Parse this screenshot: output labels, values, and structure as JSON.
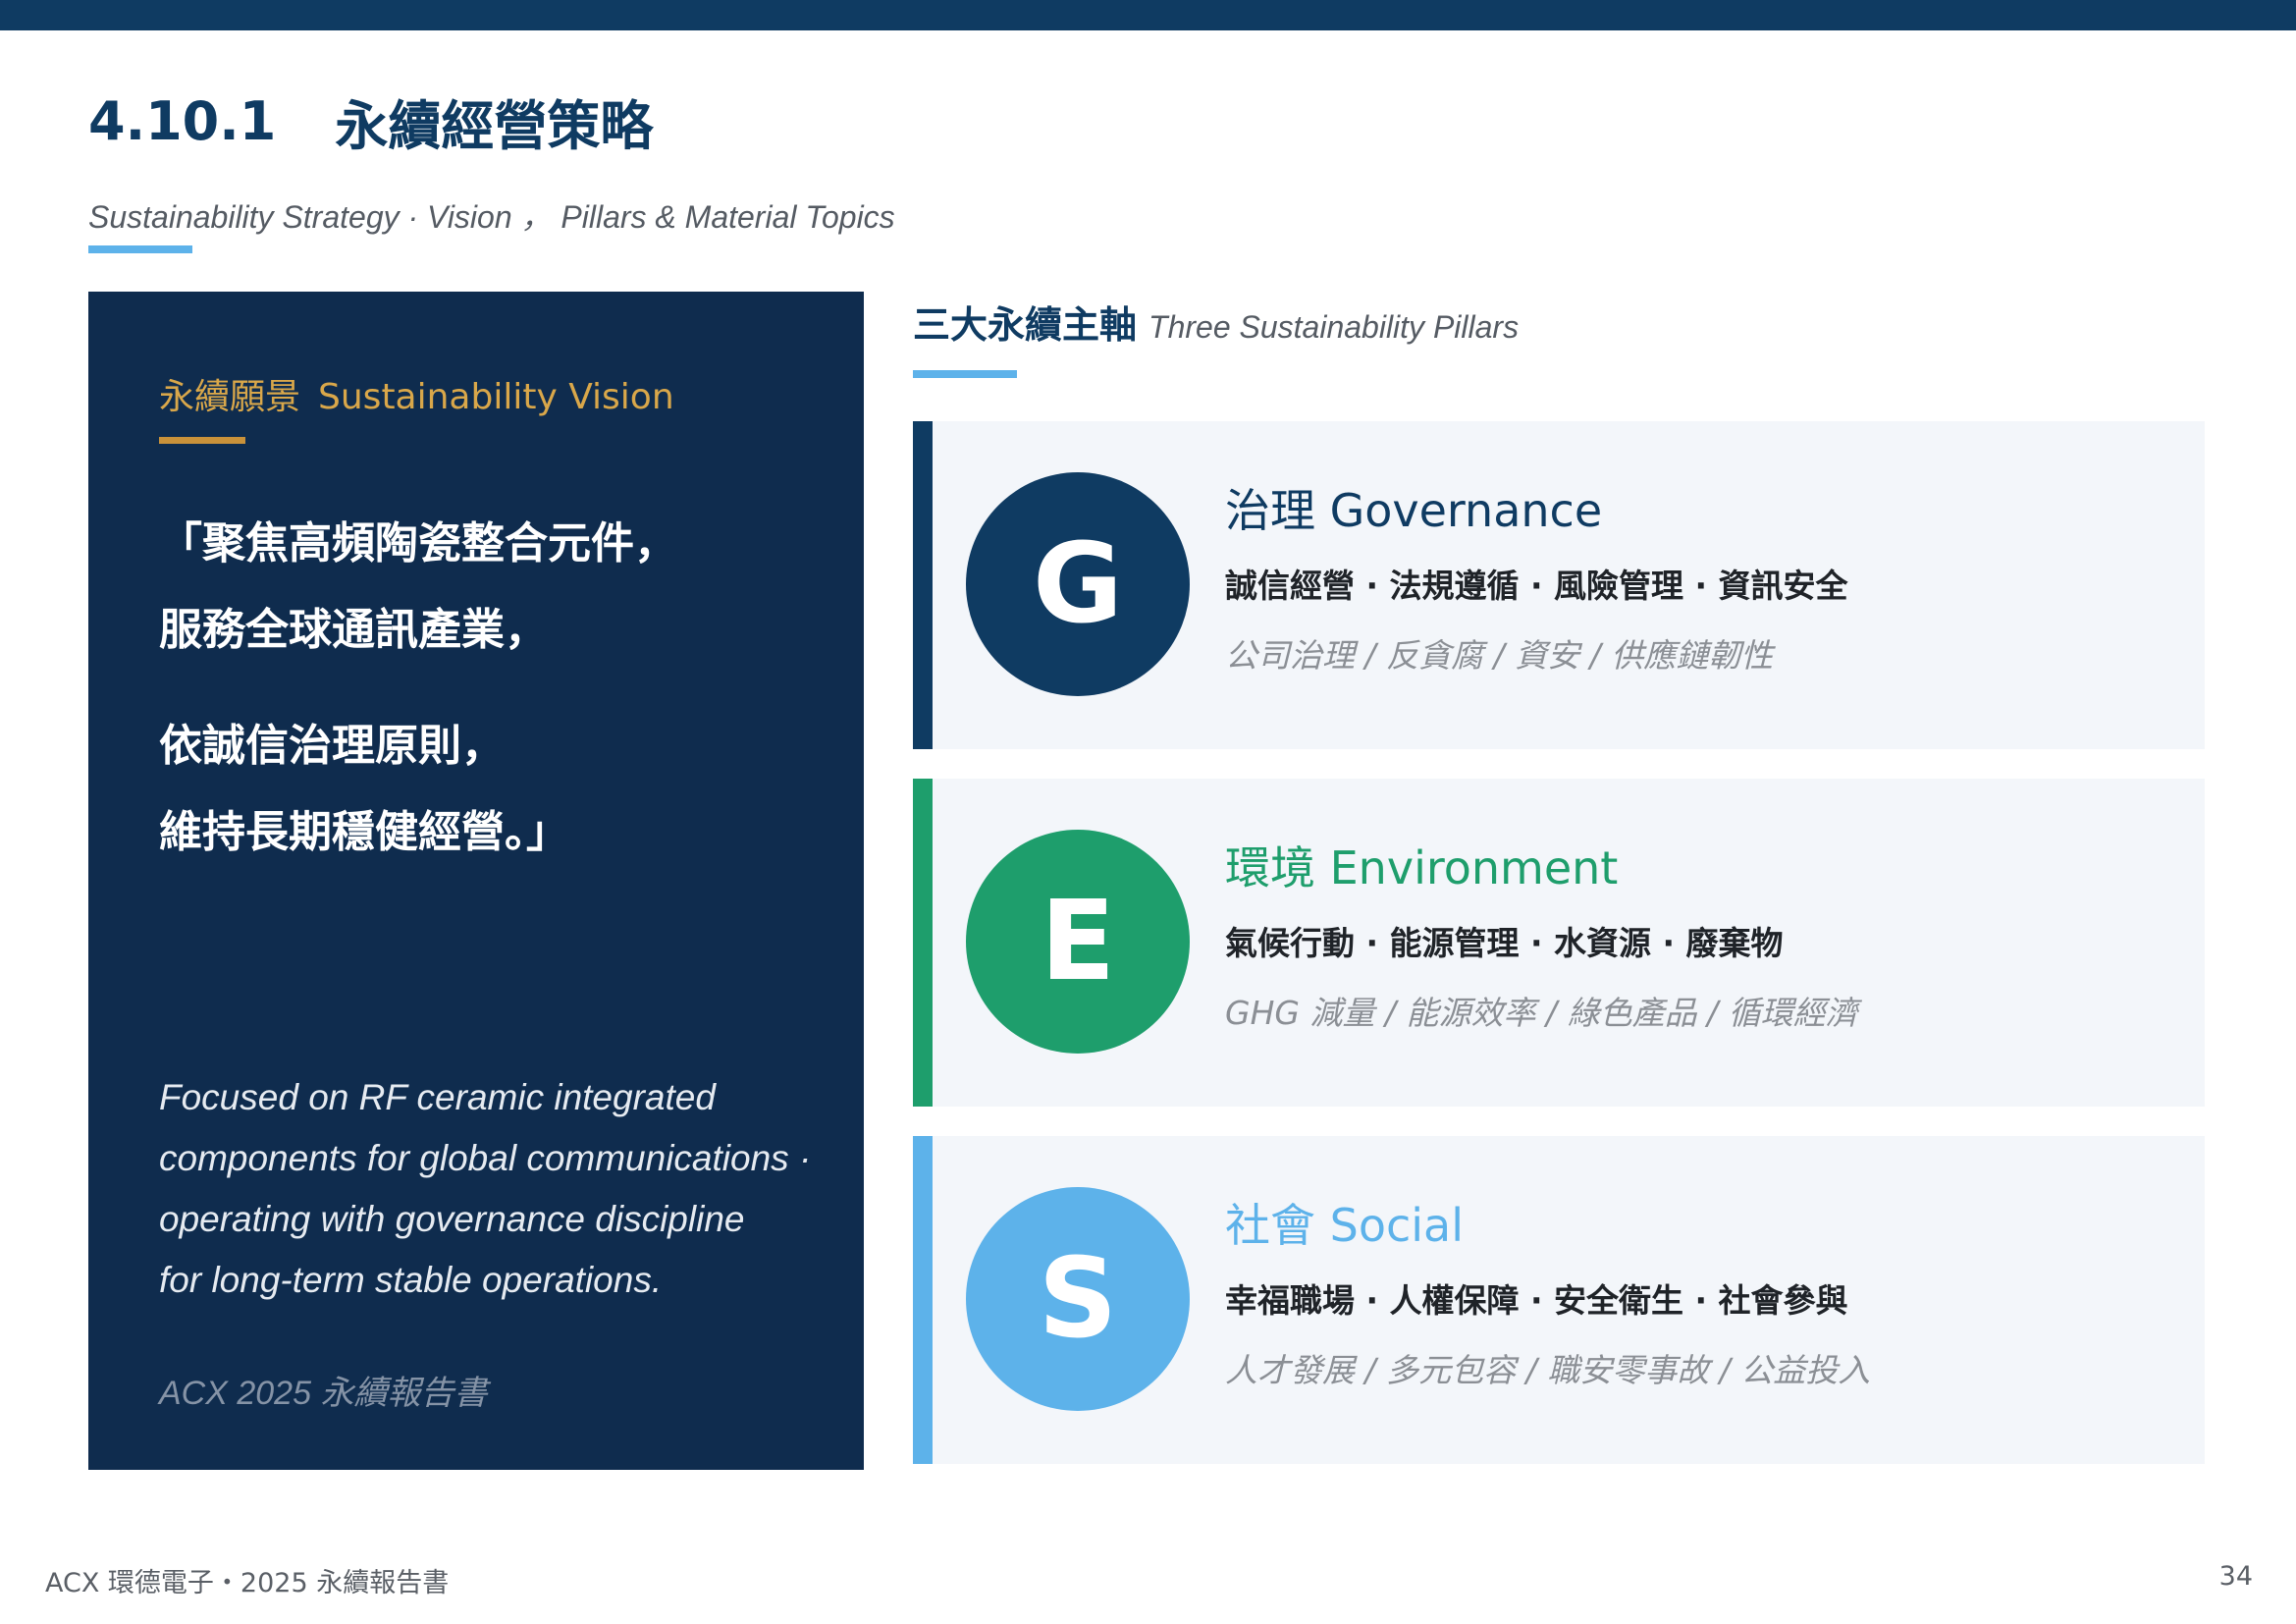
{
  "header": {
    "section_number": "4.10.1",
    "section_title": "永續經營策略",
    "subtitle": "Sustainability Strategy · Vision ， Pillars & Material Topics"
  },
  "vision": {
    "heading_zh": "永續願景",
    "heading_en": "Sustainability Vision",
    "quote_lines": [
      "「聚焦高頻陶瓷整合元件，",
      "服務全球通訊產業，",
      "依誠信治理原則，",
      "維持長期穩健經營。」"
    ],
    "english_lines": [
      "Focused on RF ceramic integrated",
      "components for global communications ·",
      "operating with governance discipline",
      "for long-term stable operations."
    ],
    "footnote": "ACX 2025 永續報告書"
  },
  "pillars": {
    "heading_zh": "三大永續主軸",
    "heading_en": "Three Sustainability Pillars",
    "items": [
      {
        "letter": "G",
        "title": "治理 Governance",
        "topics": "誠信經營 · 法規遵循 · 風險管理 · 資訊安全",
        "subtopics": "公司治理 / 反貪腐 / 資安 / 供應鏈韌性",
        "color": "#0f3b62"
      },
      {
        "letter": "E",
        "title": "環境 Environment",
        "topics": "氣候行動 · 能源管理 · 水資源 · 廢棄物",
        "subtopics": "GHG 減量 / 能源效率 / 綠色產品 / 循環經濟",
        "color": "#1e9e6c"
      },
      {
        "letter": "S",
        "title": "社會 Social",
        "topics": "幸福職場 · 人權保障 · 安全衛生 · 社會參與",
        "subtopics": "人才發展 / 多元包容 / 職安零事故 / 公益投入",
        "color": "#5db2ea"
      }
    ]
  },
  "footer": {
    "left": "ACX 環德電子・2025 永續報告書",
    "page_number": "34"
  }
}
